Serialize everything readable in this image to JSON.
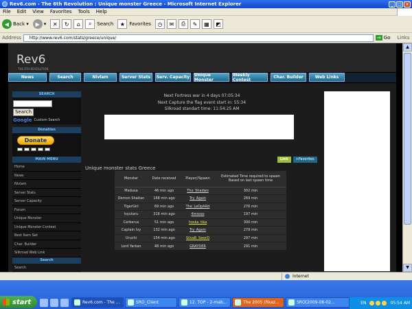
{
  "window": {
    "title": "Rev6.com - The 6th Revolution : Unique monster Greece - Microsoft Internet Explorer",
    "controls": [
      "_",
      "□",
      "×"
    ]
  },
  "menubar": [
    "File",
    "Edit",
    "View",
    "Favorites",
    "Tools",
    "Help"
  ],
  "toolbar": {
    "back": "Back",
    "search": "Search",
    "favorites": "Favorites"
  },
  "addressbar": {
    "label": "Address",
    "url": "http://www.rev6.com/stats/greece/unique/",
    "go": "Go",
    "links": "Links"
  },
  "site": {
    "logo": "Rev6",
    "tagline": "THE 6TH REVOLUTION",
    "nav": [
      "News",
      "Search",
      "Nivlam",
      "Server Stats",
      "Serv. Capacity",
      "Unique Monster",
      "Weekly Contest",
      "Char. Builder",
      "Web Links"
    ]
  },
  "sidebar": {
    "search_head": "SEARCH",
    "search_btn": "Search",
    "google": "Google",
    "google_label": "Custom Search",
    "donation_head": "Donation",
    "donate_btn": "Donate",
    "mainmenu_head": "MAIN MENU",
    "menu": [
      "Home",
      "News",
      "Nivlam",
      "Server Stats",
      "Server Capacity",
      "Forum",
      "Unique Monster",
      "Unique Monster Contest",
      "Best Item Set",
      "Char. Builder",
      "Silkroad Web Link"
    ],
    "search2_head": "Search",
    "search2_item": "Search"
  },
  "center": {
    "fortress": "Next Fortress war in 4 days 07:05:34",
    "ctf": "Next Capture the flag event start in: 55:34",
    "time": "Silkroad standart time: 11:54:25 AM",
    "link_btn": "Link",
    "fav_btn": "+Favorites",
    "title": "Unique monster stats Greece"
  },
  "table": {
    "headers": [
      "Monster",
      "Date received",
      "Player//Spawn",
      "Estimated Time required to spawn Based on last spawn time"
    ],
    "rows": [
      {
        "monster": "Medusa",
        "received": "46 min ago",
        "player": "The_Shadwo",
        "spawn": "302 min",
        "hl": false
      },
      {
        "monster": "Demon Shaitan",
        "received": "168 min ago",
        "player": "Try_Again",
        "spawn": "269 min",
        "hl": false
      },
      {
        "monster": "TigerGirl",
        "received": "69 min ago",
        "player": "The_LeOpARd",
        "spawn": "276 min",
        "hl": false
      },
      {
        "monster": "Isyutaru",
        "received": "316 min ago",
        "player": "4mrooo",
        "spawn": "197 min",
        "hl": false
      },
      {
        "monster": "Cerberus",
        "received": "51 min ago",
        "player": "hoska_tika",
        "spawn": "300 min",
        "hl": true
      },
      {
        "monster": "Captain Ivy",
        "received": "132 min ago",
        "player": "Try_Again",
        "spawn": "279 min",
        "hl": false
      },
      {
        "monster": "Uruchi",
        "received": "154 min ago",
        "player": "SilvaR_SworD",
        "spawn": "297 min",
        "hl": true
      },
      {
        "monster": "Lord Yarkan",
        "received": "48 min ago",
        "player": "GRAYDER",
        "spawn": "291 min",
        "hl": false
      }
    ]
  },
  "statusbar": {
    "zone": "Internet"
  },
  "taskbar": {
    "start": "start",
    "tasks": [
      "Rev6.com - The ...",
      "SRO_Client",
      "12. TOP - 2-mab...",
      "The 2005 (Rkaz...",
      "SRO[2009-08-02..."
    ],
    "lang": "EN",
    "clock": "05:54 AM"
  }
}
